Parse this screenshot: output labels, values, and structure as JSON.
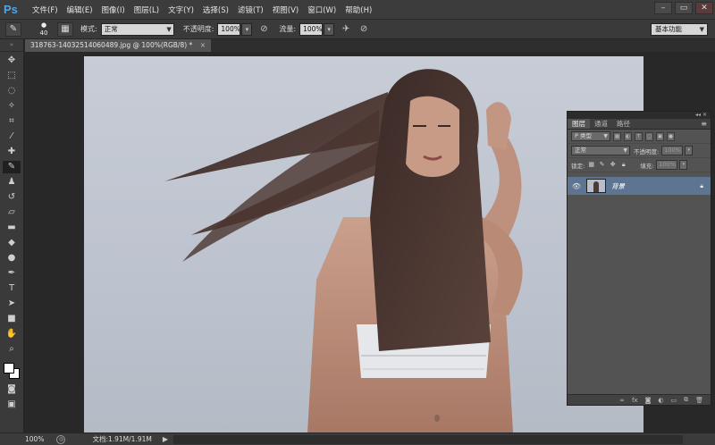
{
  "app": {
    "logo": "Ps"
  },
  "menu": [
    "文件(F)",
    "编辑(E)",
    "图像(I)",
    "图层(L)",
    "文字(Y)",
    "选择(S)",
    "滤镜(T)",
    "视图(V)",
    "窗口(W)",
    "帮助(H)"
  ],
  "window_controls": {
    "minimize": "–",
    "restore": "▭",
    "close": "✕"
  },
  "options_bar": {
    "brush_size": "40",
    "mode_label": "模式:",
    "mode_value": "正常",
    "opacity_label": "不透明度:",
    "opacity_value": "100%",
    "flow_label": "流量:",
    "flow_value": "100%",
    "workspace": "基本功能"
  },
  "document": {
    "tab_title": "318763-14032514060489.jpg @ 100%(RGB/8) *",
    "tab_close": "×"
  },
  "status": {
    "zoom": "100%",
    "doc_info": "文档:1.91M/1.91M"
  },
  "layers_panel": {
    "tabs": [
      "图层",
      "通道",
      "路径"
    ],
    "filter_label": "P 类型",
    "blend_mode": "正常",
    "opacity_label": "不透明度:",
    "opacity_value": "100%",
    "lock_label": "锁定:",
    "fill_label": "填充:",
    "fill_value": "100%",
    "layer_name": "背景"
  },
  "icons": {
    "tools": [
      "move-icon",
      "marquee-icon",
      "lasso-icon",
      "quick-select-icon",
      "crop-icon",
      "eyedropper-icon",
      "healing-icon",
      "brush-icon",
      "clone-stamp-icon",
      "history-brush-icon",
      "eraser-icon",
      "gradient-icon",
      "blur-icon",
      "dodge-icon",
      "pen-icon",
      "type-icon",
      "path-select-icon",
      "shape-icon",
      "hand-icon",
      "zoom-icon"
    ]
  },
  "colors": {
    "accent": "#4aa7e6",
    "selected_layer": "#5e7591"
  }
}
